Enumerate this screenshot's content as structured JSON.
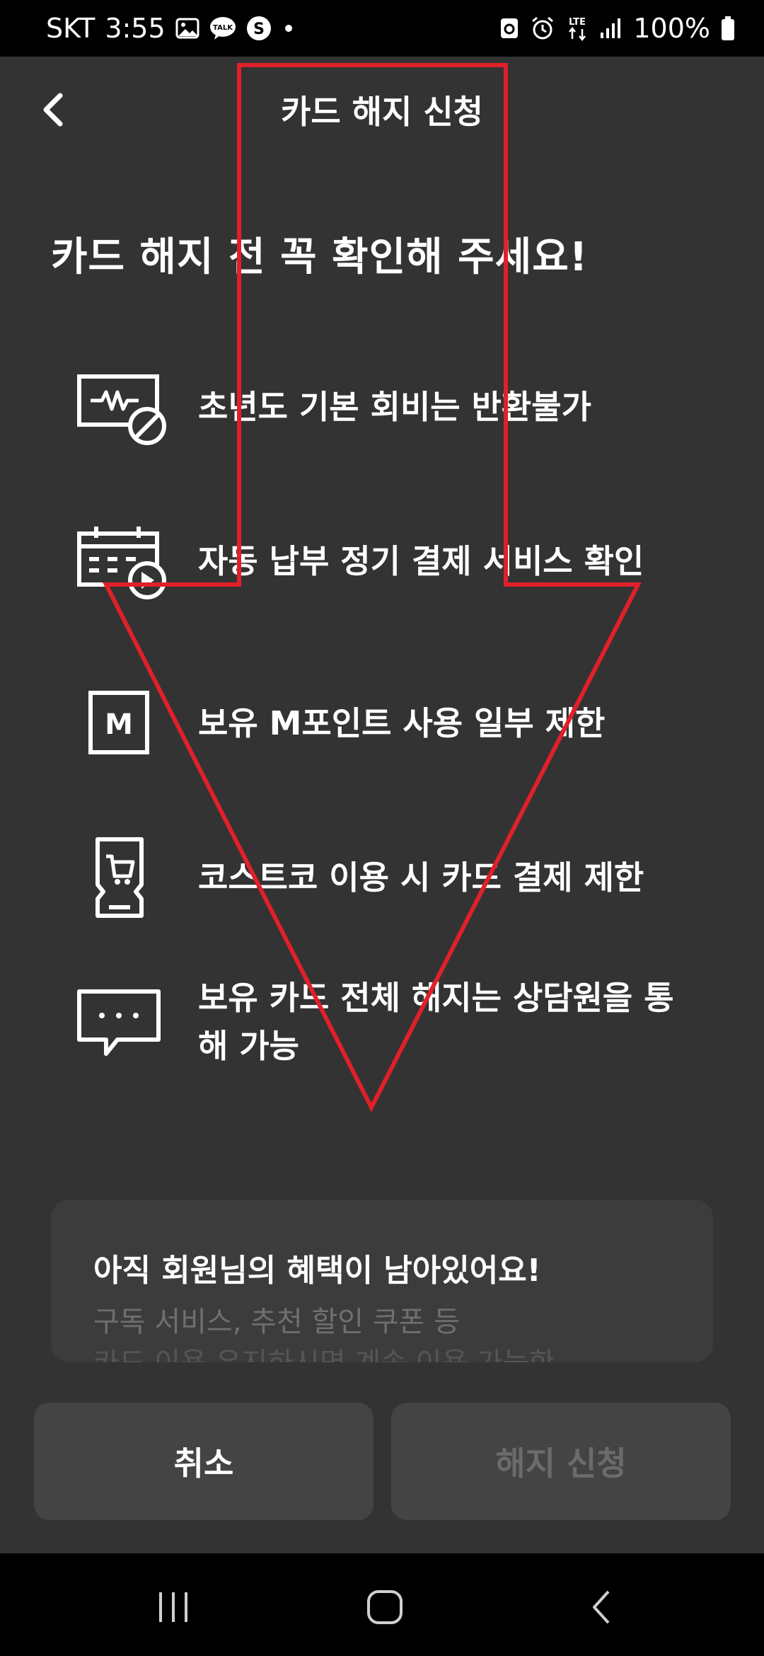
{
  "status_bar": {
    "carrier": "SKT",
    "time": "3:55",
    "battery": "100%",
    "network": "LTE",
    "talk_badge": "TALK"
  },
  "header": {
    "title": "카드 해지 신청"
  },
  "main": {
    "headline": "카드 해지 전 꼭 확인해 주세요!",
    "notices": [
      {
        "icon": "no-refund-icon",
        "text": "초년도 기본 회비는 반환불가"
      },
      {
        "icon": "calendar-payment-icon",
        "text": "자동 납부 정기 결제 서비스 확인"
      },
      {
        "icon": "m-point-icon",
        "text": "보유 M포인트 사용 일부 제한",
        "icon_letter": "M"
      },
      {
        "icon": "costco-cart-icon",
        "text": "코스트코 이용 시 카드 결제 제한"
      },
      {
        "icon": "chat-bubble-icon",
        "text_line1": "보유 카드 전체 해지는 상담원을 통",
        "text_line2": "해 가능"
      }
    ]
  },
  "benefit": {
    "title": "아직 회원님의 혜택이 남아있어요!",
    "line1": "구독 서비스, 추천 할인 쿠폰 등",
    "line2": "카드 이용 유지하시면 계속 이용 가능한"
  },
  "buttons": {
    "cancel": "취소",
    "confirm": "해지 신청"
  },
  "colors": {
    "background": "#333333",
    "annotation_arrow": "#e0202a",
    "disabled_text": "#6b6b6b"
  }
}
